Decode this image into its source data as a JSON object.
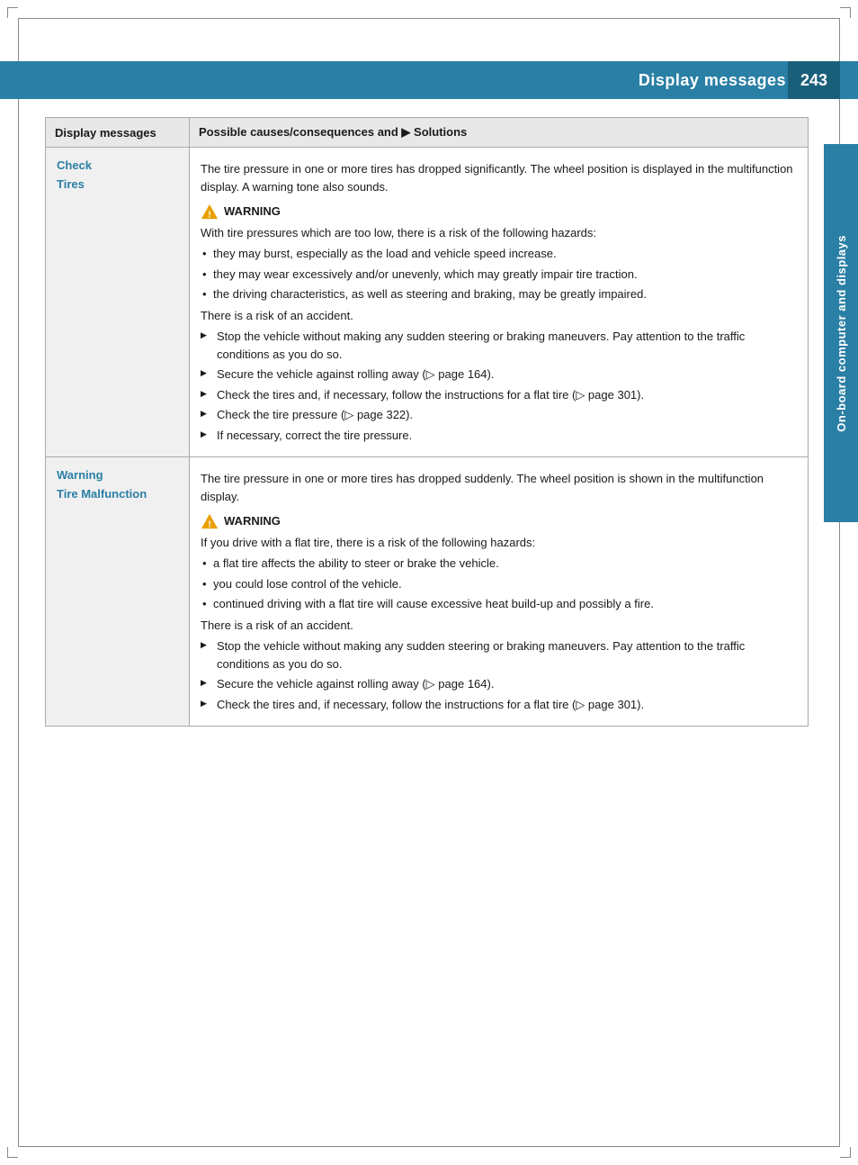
{
  "page": {
    "number": "243",
    "title": "Display messages"
  },
  "side_tab": {
    "label": "On-board computer and displays"
  },
  "table": {
    "col1_header": "Display messages",
    "col2_header": "Possible causes/consequences and ▶ Solutions"
  },
  "row1": {
    "label_line1": "Check",
    "label_line2": "Tires",
    "intro": "The tire pressure in one or more tires has dropped significantly. The wheel position is displayed in the multifunction display. A warning tone also sounds.",
    "warning_label": "WARNING",
    "warning_text": "With tire pressures which are too low, there is a risk of the following hazards:",
    "bullets": [
      "they may burst, especially as the load and vehicle speed increase.",
      "they may wear excessively and/or unevenly, which may greatly impair tire traction.",
      "the driving characteristics, as well as steering and braking, may be greatly impaired."
    ],
    "risk_text": "There is a risk of an accident.",
    "actions": [
      "Stop the vehicle without making any sudden steering or braking maneuvers. Pay attention to the traffic conditions as you do so.",
      "Secure the vehicle against rolling away (▷ page 164).",
      "Check the tires and, if necessary, follow the instructions for a flat tire (▷ page 301).",
      "Check the tire pressure (▷ page 322).",
      "If necessary, correct the tire pressure."
    ]
  },
  "row2": {
    "label_line1": "Warning",
    "label_line2": "Tire Malfunction",
    "intro": "The tire pressure in one or more tires has dropped suddenly. The wheel position is shown in the multifunction display.",
    "warning_label": "WARNING",
    "warning_text": "If you drive with a flat tire, there is a risk of the following hazards:",
    "bullets": [
      "a flat tire affects the ability to steer or brake the vehicle.",
      "you could lose control of the vehicle.",
      "continued driving with a flat tire will cause excessive heat build-up and possibly a fire."
    ],
    "risk_text": "There is a risk of an accident.",
    "actions": [
      "Stop the vehicle without making any sudden steering or braking maneuvers. Pay attention to the traffic conditions as you do so.",
      "Secure the vehicle against rolling away (▷ page 164).",
      "Check the tires and, if necessary, follow the instructions for a flat tire (▷ page 301)."
    ]
  }
}
